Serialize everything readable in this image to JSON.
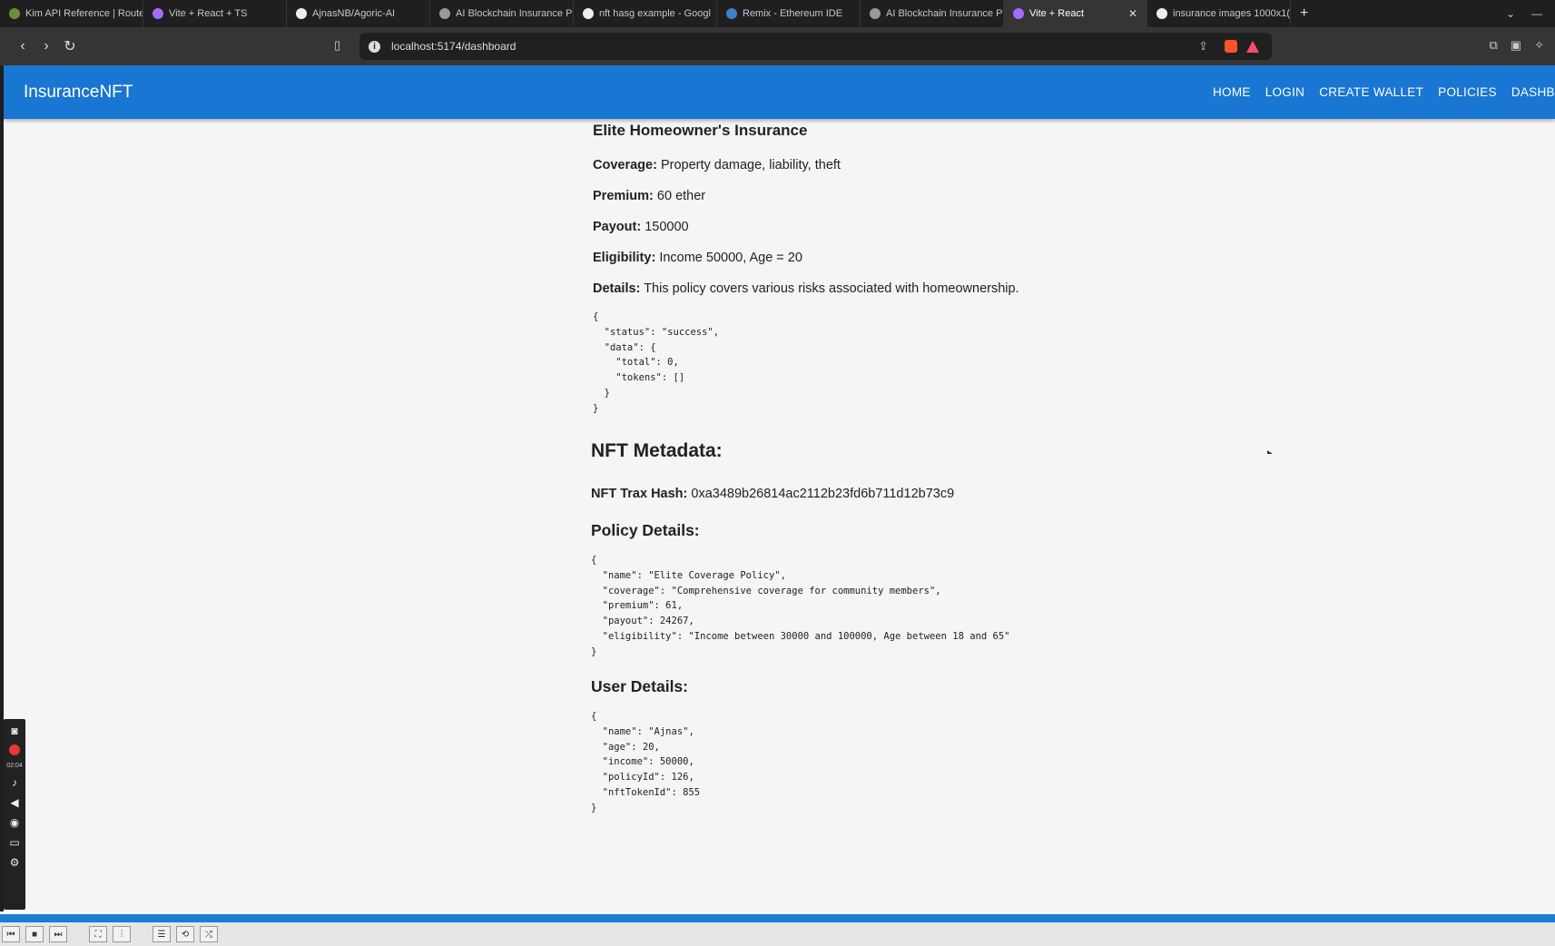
{
  "browser": {
    "tabs": [
      {
        "title": "Kim API Reference | Route",
        "color": "#6b8f3a"
      },
      {
        "title": "Vite + React + TS",
        "color": "#a56bff"
      },
      {
        "title": "AjnasNB/Agoric-AI",
        "color": "#eeeeee"
      },
      {
        "title": "AI Blockchain Insurance P",
        "color": "#999999"
      },
      {
        "title": "nft hasg example - Googl",
        "color": "#eeeeee"
      },
      {
        "title": "Remix - Ethereum IDE",
        "color": "#3b82c4"
      },
      {
        "title": "AI Blockchain Insurance P",
        "color": "#999999"
      },
      {
        "title": "Vite + React",
        "color": "#a56bff"
      },
      {
        "title": "insurance images 1000x1(",
        "color": "#eeeeee"
      }
    ],
    "active_tab_index": 7,
    "url": "localhost:5174/dashboard"
  },
  "app": {
    "brand": "InsuranceNFT",
    "nav": {
      "home": "HOME",
      "login": "LOGIN",
      "create_wallet": "CREATE WALLET",
      "policies": "POLICIES",
      "dashboard": "DASHBOARD"
    }
  },
  "policy": {
    "title": "Elite Homeowner's Insurance",
    "coverage_label": "Coverage:",
    "coverage_value": "Property damage, liability, theft",
    "premium_label": "Premium:",
    "premium_value": "60 ether",
    "payout_label": "Payout:",
    "payout_value": "150000",
    "eligibility_label": "Eligibility:",
    "eligibility_value": "Income 50000, Age = 20",
    "details_label": "Details:",
    "details_value": "This policy covers various risks associated with homeownership.",
    "response_json": "{\n  \"status\": \"success\",\n  \"data\": {\n    \"total\": 0,\n    \"tokens\": []\n  }\n}"
  },
  "nft": {
    "heading": "NFT Metadata:",
    "hash_label": "NFT Trax Hash:",
    "hash_value": "0xa3489b26814ac2112b23fd6b711d12b73c9",
    "policy_heading": "Policy Details:",
    "policy_json": "{\n  \"name\": \"Elite Coverage Policy\",\n  \"coverage\": \"Comprehensive coverage for community members\",\n  \"premium\": 61,\n  \"payout\": 24267,\n  \"eligibility\": \"Income between 30000 and 100000, Age between 18 and 65\"\n}",
    "user_heading": "User Details:",
    "user_json": "{\n  \"name\": \"Ajnas\",\n  \"age\": 20,\n  \"income\": 50000,\n  \"policyId\": 126,\n  \"nftTokenId\": 855\n}"
  },
  "recorder": {
    "time": "02:04"
  }
}
